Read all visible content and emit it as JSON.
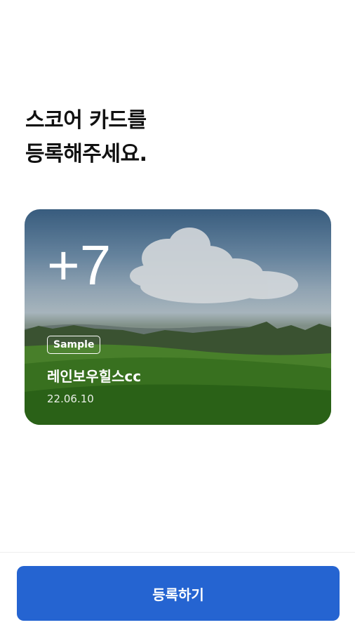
{
  "heading": {
    "line1": "스코어 카드를",
    "line2": "등록해주세요."
  },
  "card": {
    "score": "+7",
    "badge": "Sample",
    "course_name": "레인보우힐스cc",
    "date": "22.06.10"
  },
  "button": {
    "label": "등록하기"
  },
  "colors": {
    "primary": "#2564d1"
  }
}
